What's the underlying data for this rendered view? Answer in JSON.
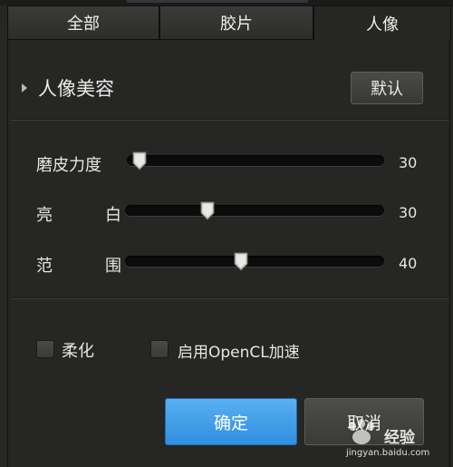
{
  "tabs": [
    {
      "label": "全部",
      "active": false
    },
    {
      "label": "胶片",
      "active": false
    },
    {
      "label": "人像",
      "active": true
    }
  ],
  "section": {
    "title": "人像美容",
    "default_button": "默认"
  },
  "sliders": [
    {
      "label": "磨皮力度",
      "value": 30,
      "position": 0.0
    },
    {
      "label_left": "亮",
      "label_right": "白",
      "value": 30,
      "position": 0.3
    },
    {
      "label_left": "范",
      "label_right": "围",
      "value": 40,
      "position": 0.44
    }
  ],
  "options": [
    {
      "label": "柔化",
      "checked": false
    },
    {
      "label": "启用OpenCL加速",
      "checked": false
    }
  ],
  "buttons": {
    "ok": "确定",
    "cancel": "取消"
  },
  "watermark": {
    "brand": "经验",
    "url": "jingyan.baidu.com"
  },
  "colors": {
    "accent": "#3a9bea",
    "background": "#262624"
  }
}
